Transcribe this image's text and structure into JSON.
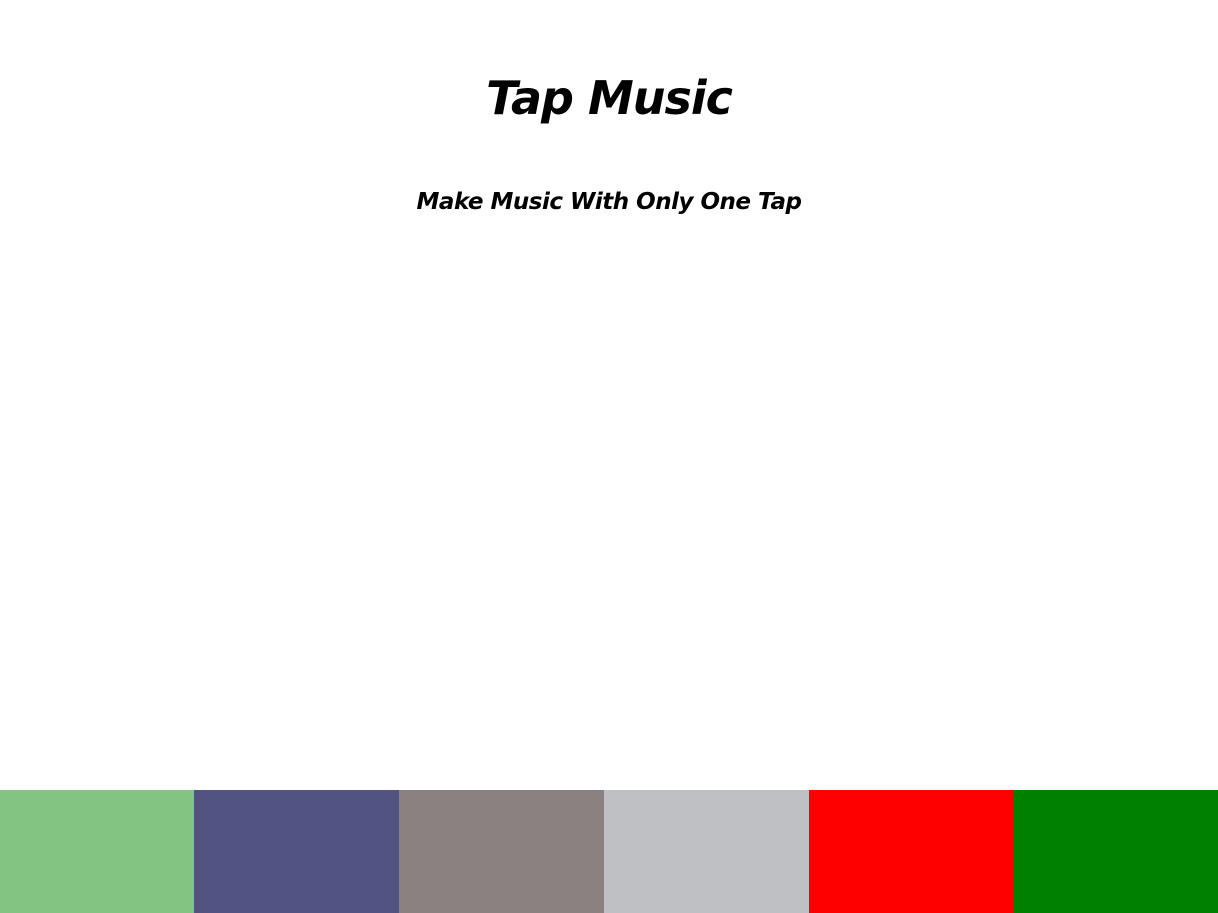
{
  "header": {
    "title": "Tap Music",
    "subtitle": "Make Music With Only One Tap"
  },
  "pads": [
    {
      "name": "pad-1",
      "color": "#83c482"
    },
    {
      "name": "pad-2",
      "color": "#525382"
    },
    {
      "name": "pad-3",
      "color": "#8c8181"
    },
    {
      "name": "pad-4",
      "color": "#bec0c4"
    },
    {
      "name": "pad-5",
      "color": "#ff0000"
    },
    {
      "name": "pad-6",
      "color": "#008000"
    }
  ]
}
